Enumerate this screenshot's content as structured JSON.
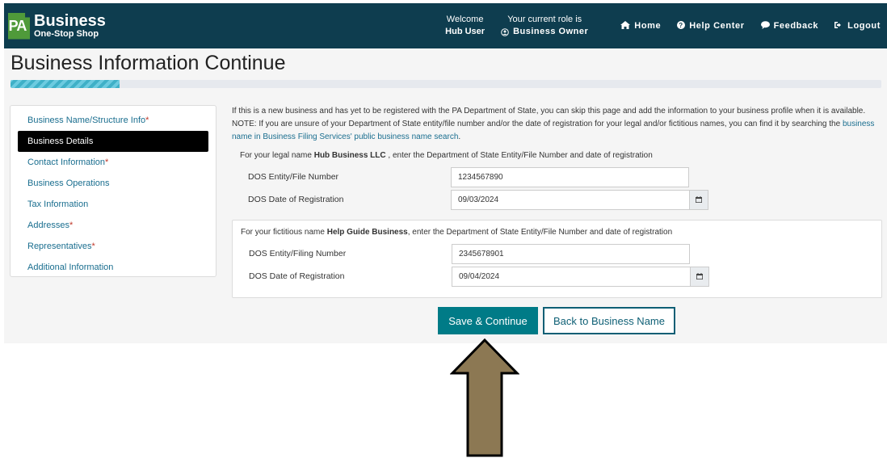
{
  "header": {
    "logo_mark": "PA",
    "logo_title": "Business",
    "logo_subtitle": "One-Stop Shop",
    "welcome_label": "Welcome",
    "welcome_user": "Hub User",
    "role_label": "Your current role is",
    "role_value": "Business Owner",
    "links": {
      "home": "Home",
      "help": "Help Center",
      "feedback": "Feedback",
      "logout": "Logout"
    }
  },
  "page": {
    "title": "Business Information Continue",
    "progress_fraction": 0.125
  },
  "sidebar": {
    "items": [
      {
        "label": "Business Name/Structure Info",
        "required": "*"
      },
      {
        "label": "Business Details",
        "required": ""
      },
      {
        "label": "Contact Information",
        "required": "*"
      },
      {
        "label": "Business Operations",
        "required": ""
      },
      {
        "label": "Tax Information",
        "required": ""
      },
      {
        "label": "Addresses",
        "required": "*"
      },
      {
        "label": "Representatives",
        "required": "*"
      },
      {
        "label": "Additional Information",
        "required": ""
      }
    ]
  },
  "content": {
    "intro_text": "If this is a new business and has yet to be registered with the PA Department of State, you can skip this page and add the information to your business profile when it is available. NOTE: If you are unsure of your Department of State entity/file number and/or the date of registration for your legal and/or fictitious names, you can find it by searching the ",
    "intro_link": "business name in Business Filing Services' public business name search",
    "intro_end": ".",
    "legal": {
      "prefix": "For your legal name ",
      "name": "Hub Business LLC",
      "suffix": " , enter the Department of State Entity/File Number and date of registration",
      "entity_label": "DOS Entity/File Number",
      "entity_value": "1234567890",
      "date_label": "DOS Date of Registration",
      "date_value": "09/03/2024"
    },
    "fictitious": {
      "prefix": "For your fictitious name ",
      "name": "Help Guide Business",
      "suffix": ", enter the Department of State Entity/File Number and date of registration",
      "entity_label": "DOS Entity/Filing Number",
      "entity_value": "2345678901",
      "date_label": "DOS Date of Registration",
      "date_value": "09/04/2024"
    }
  },
  "actions": {
    "save": "Save & Continue",
    "back": "Back to Business Name"
  },
  "colors": {
    "header_bg": "#0e3d4f",
    "primary": "#007b87",
    "link": "#1a6e8f",
    "arrow_fill": "#8c7853"
  }
}
